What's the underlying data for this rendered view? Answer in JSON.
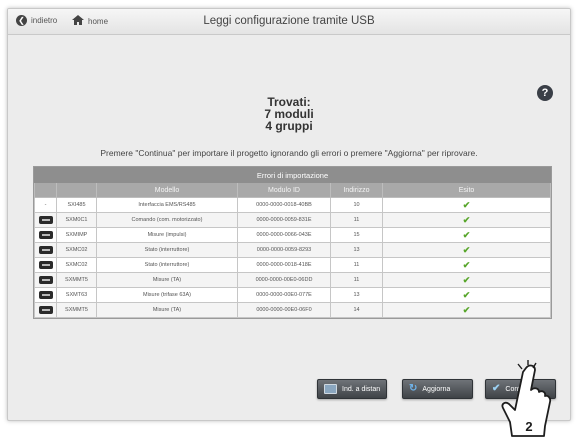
{
  "topbar": {
    "back_label": "indietro",
    "home_label": "home",
    "title": "Leggi configurazione tramite USB"
  },
  "summary": {
    "line1": "Trovati:",
    "line2": "7 moduli",
    "line3": "4 gruppi"
  },
  "help": {
    "label": "?"
  },
  "instruction": "Premere \"Continua\" per importare il progetto ignorando gli errori o premere \"Aggiorna\" per riprovare.",
  "table": {
    "caption": "Errori di importazione",
    "columns": [
      "",
      "",
      "Modello",
      "Modulo ID",
      "Indirizzo",
      "Esito"
    ],
    "rows": [
      {
        "icon": "dash",
        "code": "SXI485",
        "model": "Interfaccia EMS/RS485",
        "module_id": "0000-0000-0018-40BB",
        "address": "10",
        "result": "✔"
      },
      {
        "icon": "device-icon",
        "code": "SXM0C1",
        "model": "Comando (com. motorizzato)",
        "module_id": "0000-0000-0059-831E",
        "address": "11",
        "result": "✔"
      },
      {
        "icon": "device-icon",
        "code": "SXMIMP",
        "model": "Misure (impulsi)",
        "module_id": "0000-0000-0066-043E",
        "address": "15",
        "result": "✔"
      },
      {
        "icon": "device-icon",
        "code": "SXMC02",
        "model": "Stato (interruttore)",
        "module_id": "0000-0000-0059-8293",
        "address": "13",
        "result": "✔"
      },
      {
        "icon": "device-icon",
        "code": "SXMC02",
        "model": "Stato (interruttore)",
        "module_id": "0000-0000-0018-418E",
        "address": "11",
        "result": "✔"
      },
      {
        "icon": "device-icon",
        "code": "SXMMT5",
        "model": "Misure (TA)",
        "module_id": "0000-0000-00E0-06DD",
        "address": "11",
        "result": "✔"
      },
      {
        "icon": "device-icon",
        "code": "SXMT63",
        "model": "Misure (trifase 63A)",
        "module_id": "0000-0000-00E0-077E",
        "address": "13",
        "result": "✔"
      },
      {
        "icon": "device-icon",
        "code": "SXMMT5",
        "model": "Misure (TA)",
        "module_id": "0000-0000-00E0-06F0",
        "address": "14",
        "result": "✔"
      }
    ]
  },
  "buttons": {
    "remote_label": "Ind. a distan",
    "update_label": "Aggiorna",
    "continue_label": "Continu"
  },
  "callout": {
    "step": "2"
  },
  "colors": {
    "check": "#58a62b",
    "header": "#a9a9a9",
    "button": "#4f5357"
  }
}
